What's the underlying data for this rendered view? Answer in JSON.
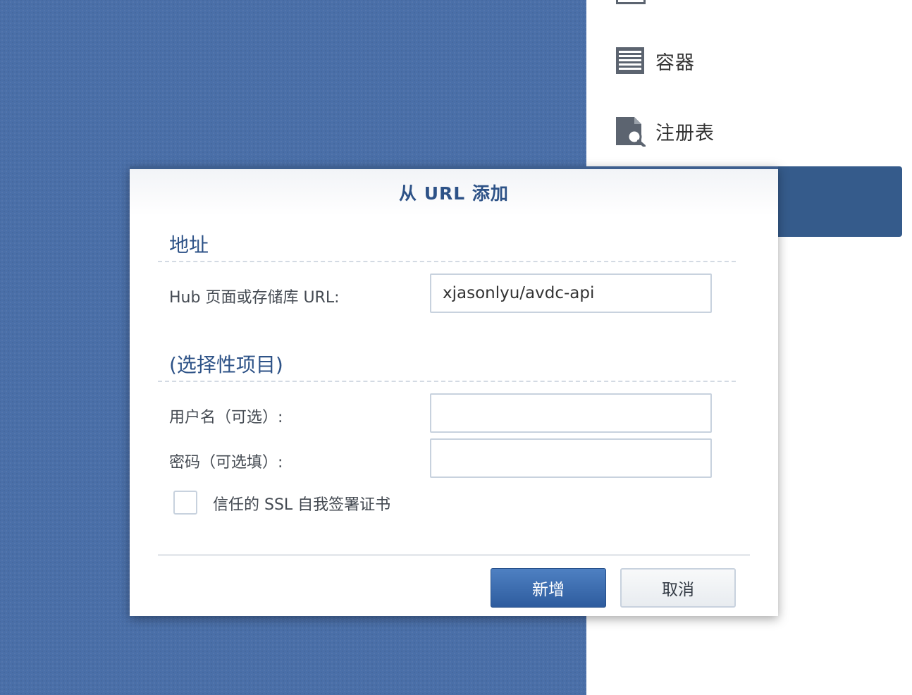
{
  "sidebar": {
    "items": [
      {
        "label": "容器",
        "icon": "container-list-icon"
      },
      {
        "label": "注册表",
        "icon": "registry-search-icon"
      }
    ]
  },
  "dialog": {
    "title": "从 URL 添加",
    "section_address": "地址",
    "hub_label": "Hub 页面或存储库 URL:",
    "hub_value": "xjasonlyu/avdc-api",
    "section_optional": "(选择性项目)",
    "username_label": "用户名（可选）:",
    "username_value": "",
    "password_label": "密码（可选填）:",
    "password_value": "",
    "trust_ssl_label": "信任的 SSL 自我签署证书",
    "trust_ssl_checked": false,
    "add_button": "新增",
    "cancel_button": "取消"
  },
  "colors": {
    "desktop": "#4a6fa8",
    "accent": "#2d5287",
    "primary_button": "#2e5c9e"
  }
}
